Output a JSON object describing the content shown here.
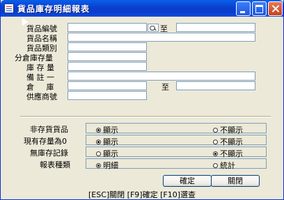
{
  "window": {
    "title": "貨品庫存明細報表"
  },
  "form": {
    "fields": [
      {
        "label": "貨品編號",
        "value": "",
        "to_label": "至",
        "to_value": ""
      },
      {
        "label": "貨品名稱",
        "value": ""
      },
      {
        "label": "貨品類別",
        "value": ""
      },
      {
        "label": "分倉庫存量",
        "value": ""
      },
      {
        "label": "庫 存 量",
        "value": ""
      },
      {
        "label": "備 註 一",
        "value": ""
      },
      {
        "label": "倉     庫",
        "value": "",
        "to_label": "至",
        "to_value": ""
      },
      {
        "label": "供應商號",
        "value": ""
      }
    ]
  },
  "options": [
    {
      "label": "非存貨貨品",
      "choices": [
        "顯示",
        "不顯示"
      ],
      "selected": "顯示"
    },
    {
      "label": "現有存量為0",
      "choices": [
        "顯示",
        "不顯示"
      ],
      "selected": "顯示"
    },
    {
      "label": "無庫存記錄",
      "choices": [
        "顯示",
        "不顯示"
      ],
      "selected": "不顯示"
    },
    {
      "label": "報表種類",
      "choices": [
        "明細",
        "統計"
      ],
      "selected": "明細"
    }
  ],
  "buttons": {
    "confirm": "確定",
    "close": "關閉"
  },
  "status_bar": "[ESC]關閉 [F9]確定 [F10]選查",
  "colors": {
    "titlebar": "#0a3fd0",
    "window_bg": "#ece9d8",
    "field_border": "#7f9db9"
  }
}
